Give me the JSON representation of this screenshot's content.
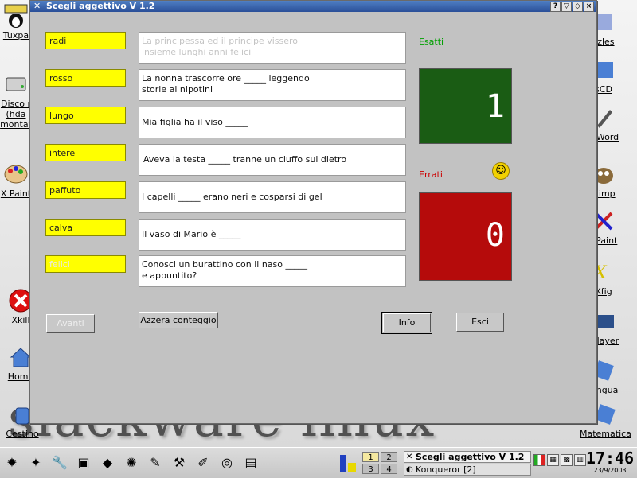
{
  "desktop": {
    "wallpaper_text": "slackware linux",
    "left_icons": [
      {
        "label": "Tuxpa",
        "icon": "tuxpaint-icon"
      },
      {
        "label": "Disco r\n(hda\nmontat",
        "icon": "hard-disk-icon"
      },
      {
        "label": "X Paint",
        "icon": "xpaint-palette-icon"
      },
      {
        "label": "Xkill",
        "icon": "xkill-icon"
      },
      {
        "label": "Home",
        "icon": "home-icon"
      },
      {
        "label": "Cestino",
        "icon": "trash-icon"
      }
    ],
    "right_icons": [
      {
        "label": "zzles",
        "icon": "puzzles-icon"
      },
      {
        "label": "sCD",
        "icon": "cd-icon"
      },
      {
        "label": "biWord",
        "icon": "abiword-icon"
      },
      {
        "label": "Gimp",
        "icon": "gimp-icon"
      },
      {
        "label": "XPaint",
        "icon": "xpaint-icon"
      },
      {
        "label": "Xfig",
        "icon": "xfig-icon"
      },
      {
        "label": "fplayer",
        "icon": "player-icon"
      },
      {
        "label": "Lingua",
        "icon": "lingua-icon"
      },
      {
        "label": "Matematica",
        "icon": "math-icon"
      }
    ]
  },
  "window": {
    "title": "Scegli aggettivo V 1.2",
    "title_buttons": [
      "?",
      "▽",
      "◇",
      "×"
    ]
  },
  "adjectives": [
    "radi",
    "rosso",
    "lungo",
    "intere",
    "paffuto",
    "calva",
    "felici"
  ],
  "sentences": [
    "La principessa ed il principe vissero\ninsieme lunghi anni  felici",
    "La nonna trascorre ore _____  leggendo\nstorie ai nipotini",
    "Mia figlia ha il viso _____",
    "Aveva la testa _____  tranne un ciuffo sul dietro",
    "I capelli _____  erano neri e cosparsi di gel",
    "Il vaso di Mario è _____",
    "Conosci un burattino con il naso  _____\ne appuntito?"
  ],
  "scores": {
    "correct_label": "Esatti",
    "correct_value": "1",
    "wrong_label": "Errati",
    "wrong_value": "0",
    "correct_color": "#1a5c14",
    "wrong_color": "#b50b0b"
  },
  "buttons": {
    "next": "Avanti",
    "reset": "Azzera conteggio",
    "info": "Info",
    "exit": "Esci"
  },
  "taskbar": {
    "launchers": [
      "settings-icon",
      "kde-control-icon",
      "wrench-icon",
      "file-manager-icon",
      "package-icon",
      "network-icon",
      "paint-icon",
      "tools-icon",
      "editor-icon",
      "help-lifebuoy-icon",
      "toolbox-icon"
    ],
    "pager": [
      "1",
      "2",
      "3",
      "4"
    ],
    "tasks": [
      {
        "label": "Scegli aggettivo V 1.2",
        "active": true
      },
      {
        "label": "Konqueror [2]",
        "active": false
      }
    ],
    "time": "17:46",
    "date": "23/9/2003"
  }
}
